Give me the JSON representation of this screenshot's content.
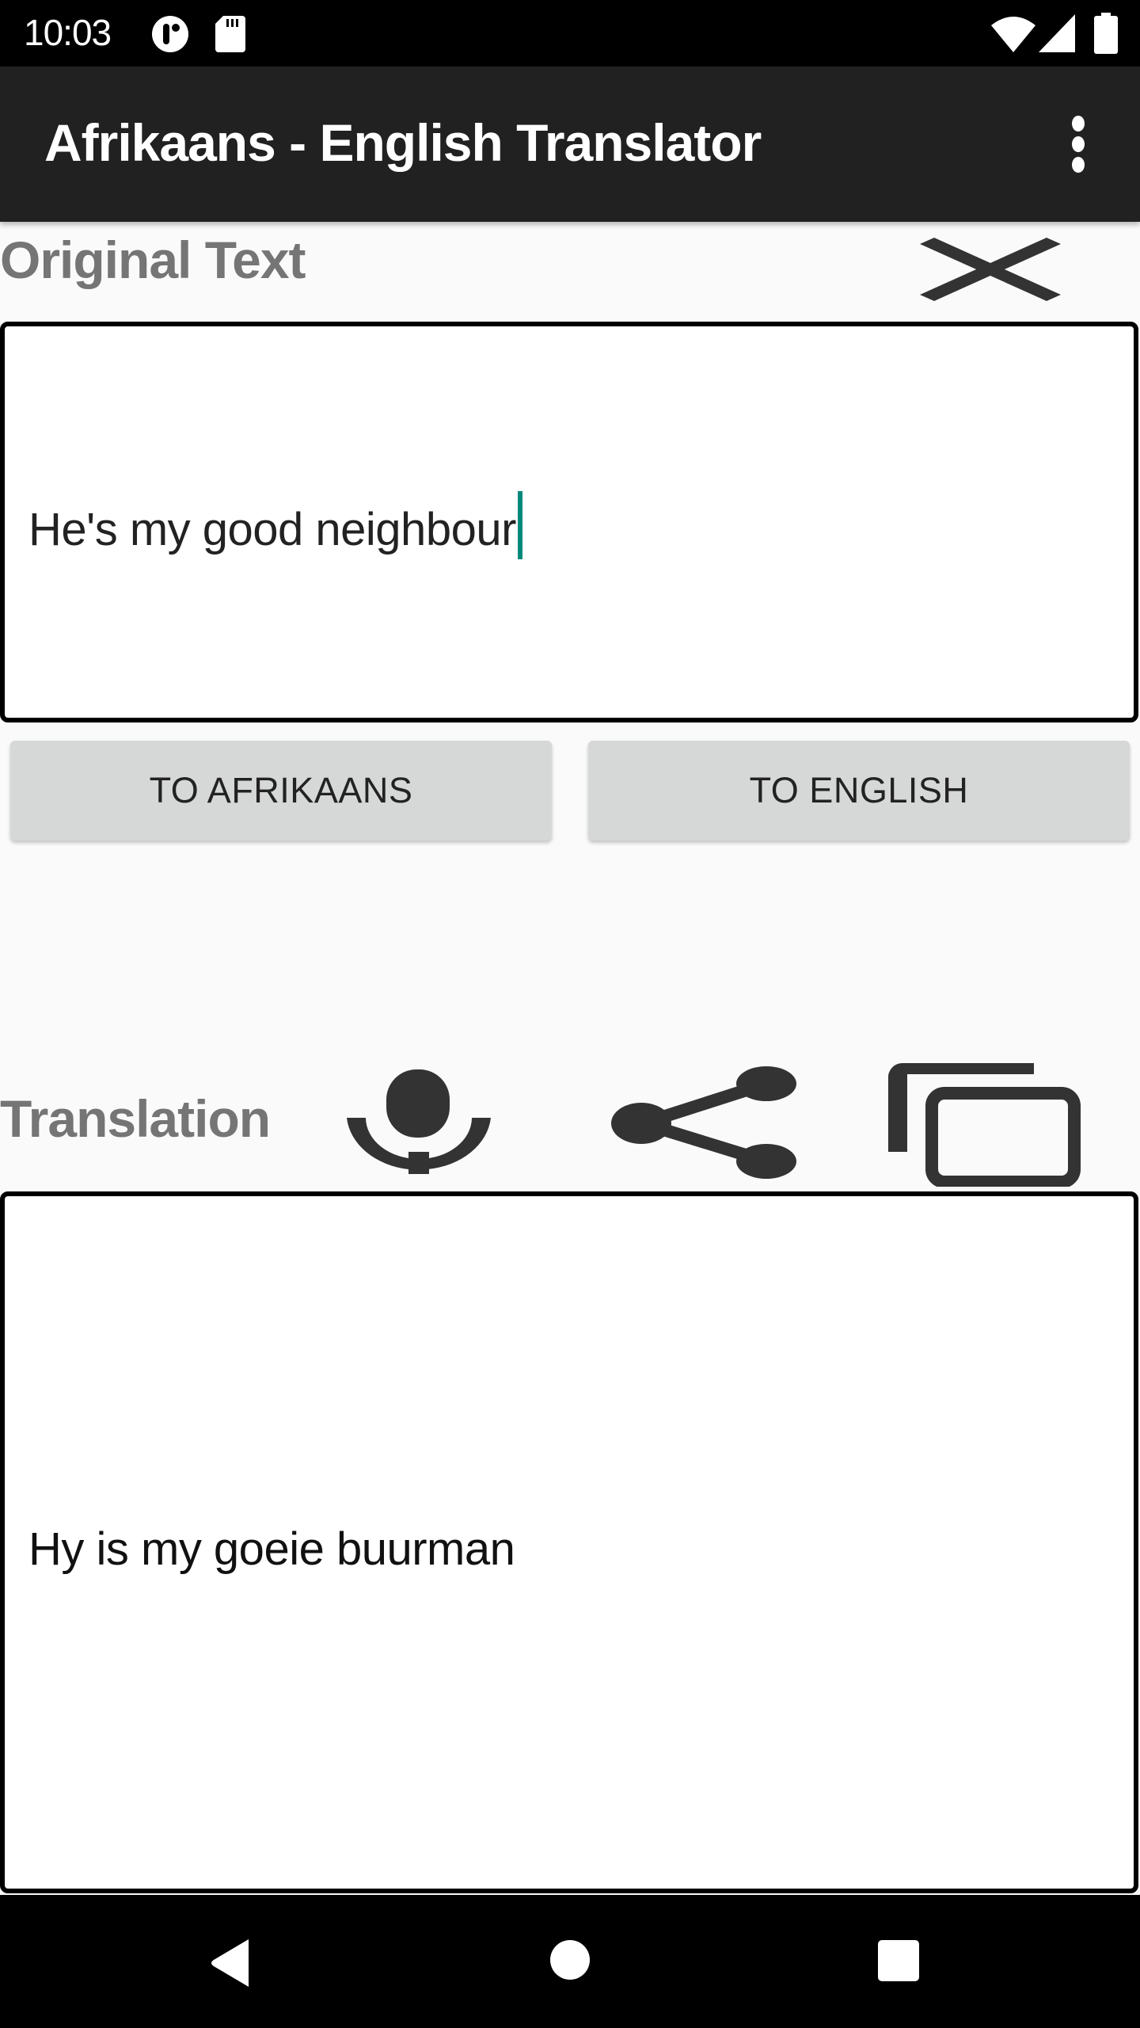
{
  "status_bar": {
    "time": "10:03",
    "left_icons": [
      "notification-app-icon",
      "sd-card-icon"
    ],
    "right_icons": [
      "wifi-icon",
      "cell-signal-icon",
      "battery-icon"
    ]
  },
  "app_bar": {
    "title": "Afrikaans - English Translator",
    "menu_icon": "more-vert-icon"
  },
  "original": {
    "label": "Original Text",
    "clear_icon": "clear-icon",
    "input_value": "He's my good neighbour"
  },
  "buttons": {
    "to_afrikaans": "TO AFRIKAANS",
    "to_english": "TO ENGLISH"
  },
  "translation": {
    "label": "Translation",
    "icons": [
      "mic-icon",
      "share-icon",
      "copy-icon"
    ],
    "output_value": "Hy is my goeie buurman"
  },
  "nav_bar": {
    "icons": [
      "back-icon",
      "home-icon",
      "recents-icon"
    ]
  },
  "colors": {
    "app_bar": "#212121",
    "caret": "#00897b",
    "label": "#757575",
    "button": "#d6d7d7"
  }
}
